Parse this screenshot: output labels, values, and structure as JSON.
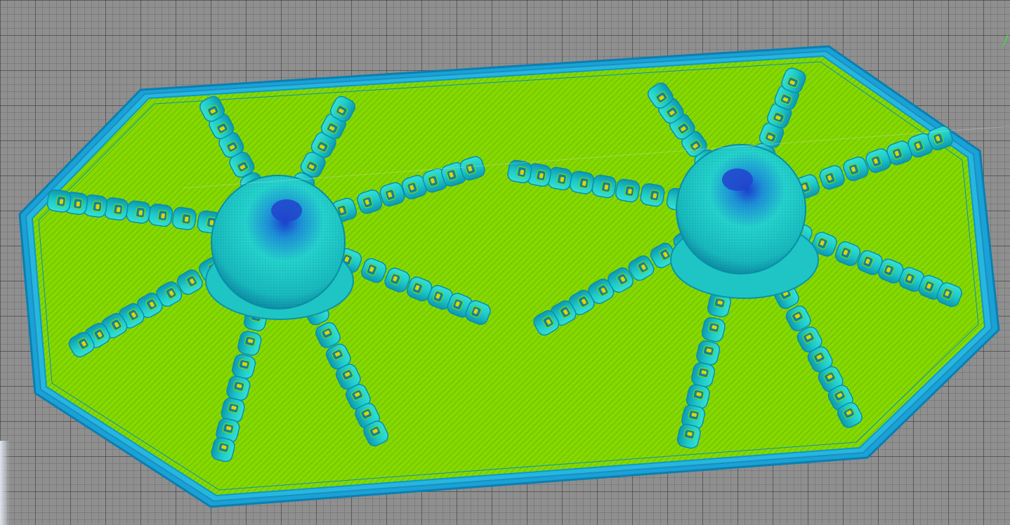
{
  "viewer": {
    "background_color": "#8f8f8f",
    "grid_line_color": "#3c3c3c",
    "plate_fill_color": "#7fd600",
    "plate_edge_color": "#1ea8d8",
    "plate_outline_color": "#0b7fb0",
    "model_surface_color": "#22d3c8",
    "model_shell_color": "#0fa9b8",
    "model_top_color": "#2450d0",
    "axis_color": "#39e639",
    "objects": [
      {
        "name": "octopus-left",
        "type": "sliced-model"
      },
      {
        "name": "octopus-right",
        "type": "sliced-model"
      }
    ]
  }
}
